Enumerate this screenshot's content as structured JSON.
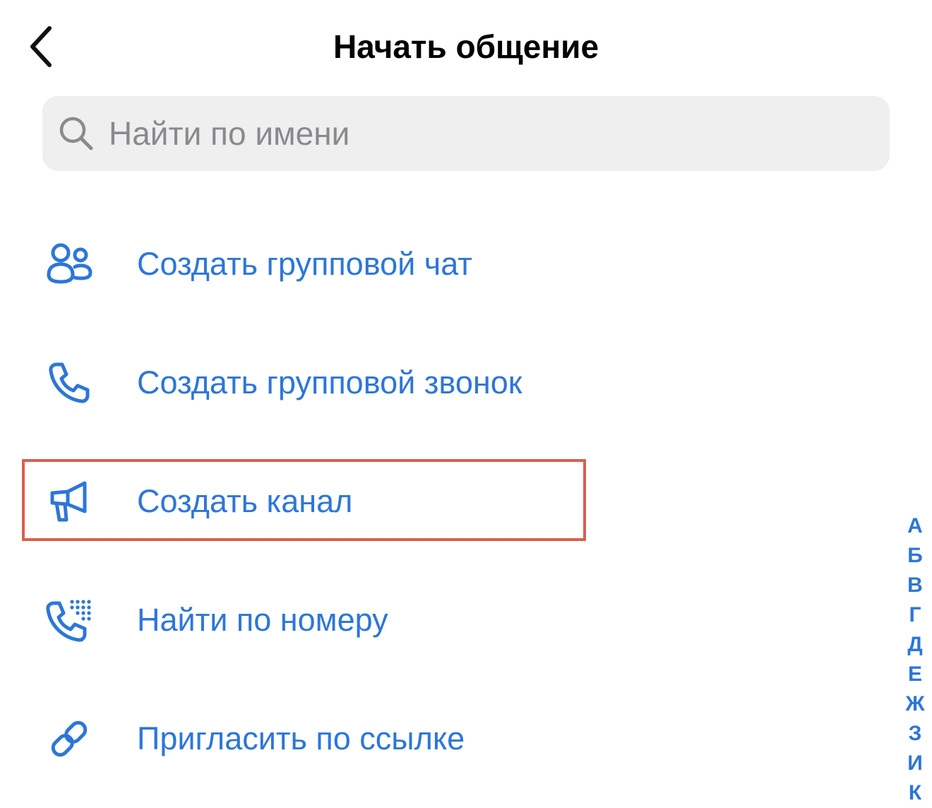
{
  "header": {
    "title": "Начать общение"
  },
  "search": {
    "placeholder": "Найти по имени",
    "value": ""
  },
  "actions": [
    {
      "label": "Создать групповой чат",
      "icon": "group-icon"
    },
    {
      "label": "Создать групповой звонок",
      "icon": "phone-icon"
    },
    {
      "label": "Создать канал",
      "icon": "megaphone-icon"
    },
    {
      "label": "Найти по номеру",
      "icon": "dialpad-phone-icon"
    },
    {
      "label": "Пригласить по ссылке",
      "icon": "link-icon"
    }
  ],
  "alphabet_index": [
    "А",
    "Б",
    "В",
    "Г",
    "Д",
    "Е",
    "Ж",
    "З",
    "И",
    "К"
  ],
  "colors": {
    "accent": "#2d76d8",
    "highlight": "#d9604d",
    "search_bg": "#efefef"
  }
}
